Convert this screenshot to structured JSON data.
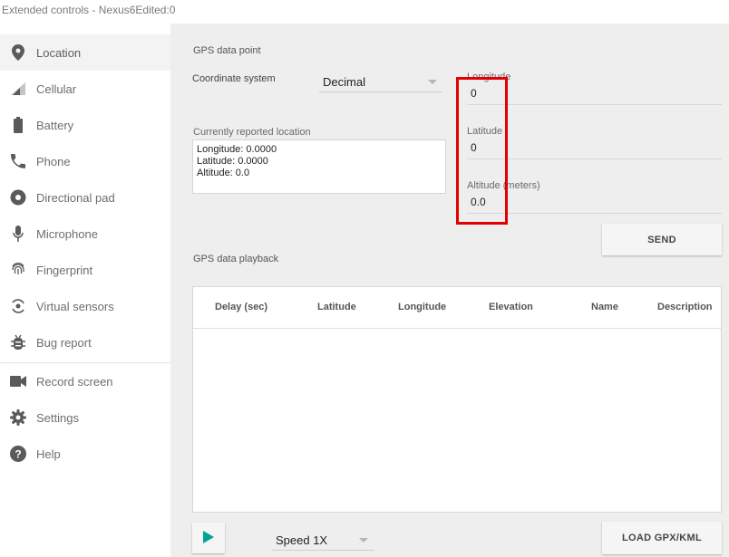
{
  "window": {
    "title": "Extended controls - Nexus6Edited:0"
  },
  "sidebar": {
    "items": [
      {
        "label": "Location",
        "icon": "location-pin-icon"
      },
      {
        "label": "Cellular",
        "icon": "signal-icon"
      },
      {
        "label": "Battery",
        "icon": "battery-icon"
      },
      {
        "label": "Phone",
        "icon": "phone-icon"
      },
      {
        "label": "Directional pad",
        "icon": "dpad-icon"
      },
      {
        "label": "Microphone",
        "icon": "microphone-icon"
      },
      {
        "label": "Fingerprint",
        "icon": "fingerprint-icon"
      },
      {
        "label": "Virtual sensors",
        "icon": "rotation-icon"
      },
      {
        "label": "Bug report",
        "icon": "bug-icon"
      },
      {
        "label": "Record screen",
        "icon": "video-camera-icon"
      },
      {
        "label": "Settings",
        "icon": "gear-icon"
      },
      {
        "label": "Help",
        "icon": "help-icon"
      }
    ]
  },
  "gps_point": {
    "title": "GPS data point",
    "coord_label": "Coordinate system",
    "coord_value": "Decimal",
    "reported_label": "Currently reported location",
    "reported_lines": [
      "Longitude: 0.0000",
      "Latitude: 0.0000",
      "Altitude: 0.0"
    ],
    "longitude_label": "Longitude",
    "longitude_value": "0",
    "latitude_label": "Latitude",
    "latitude_value": "0",
    "altitude_label": "Altitude (meters)",
    "altitude_value": "0.0",
    "send_label": "SEND"
  },
  "playback": {
    "title": "GPS data playback",
    "columns": [
      "Delay (sec)",
      "Latitude",
      "Longitude",
      "Elevation",
      "Name",
      "Description"
    ],
    "rows": [],
    "speed_value": "Speed 1X",
    "load_label": "LOAD GPX/KML"
  },
  "colors": {
    "accent": "#00a693",
    "highlight": "#e30000"
  }
}
